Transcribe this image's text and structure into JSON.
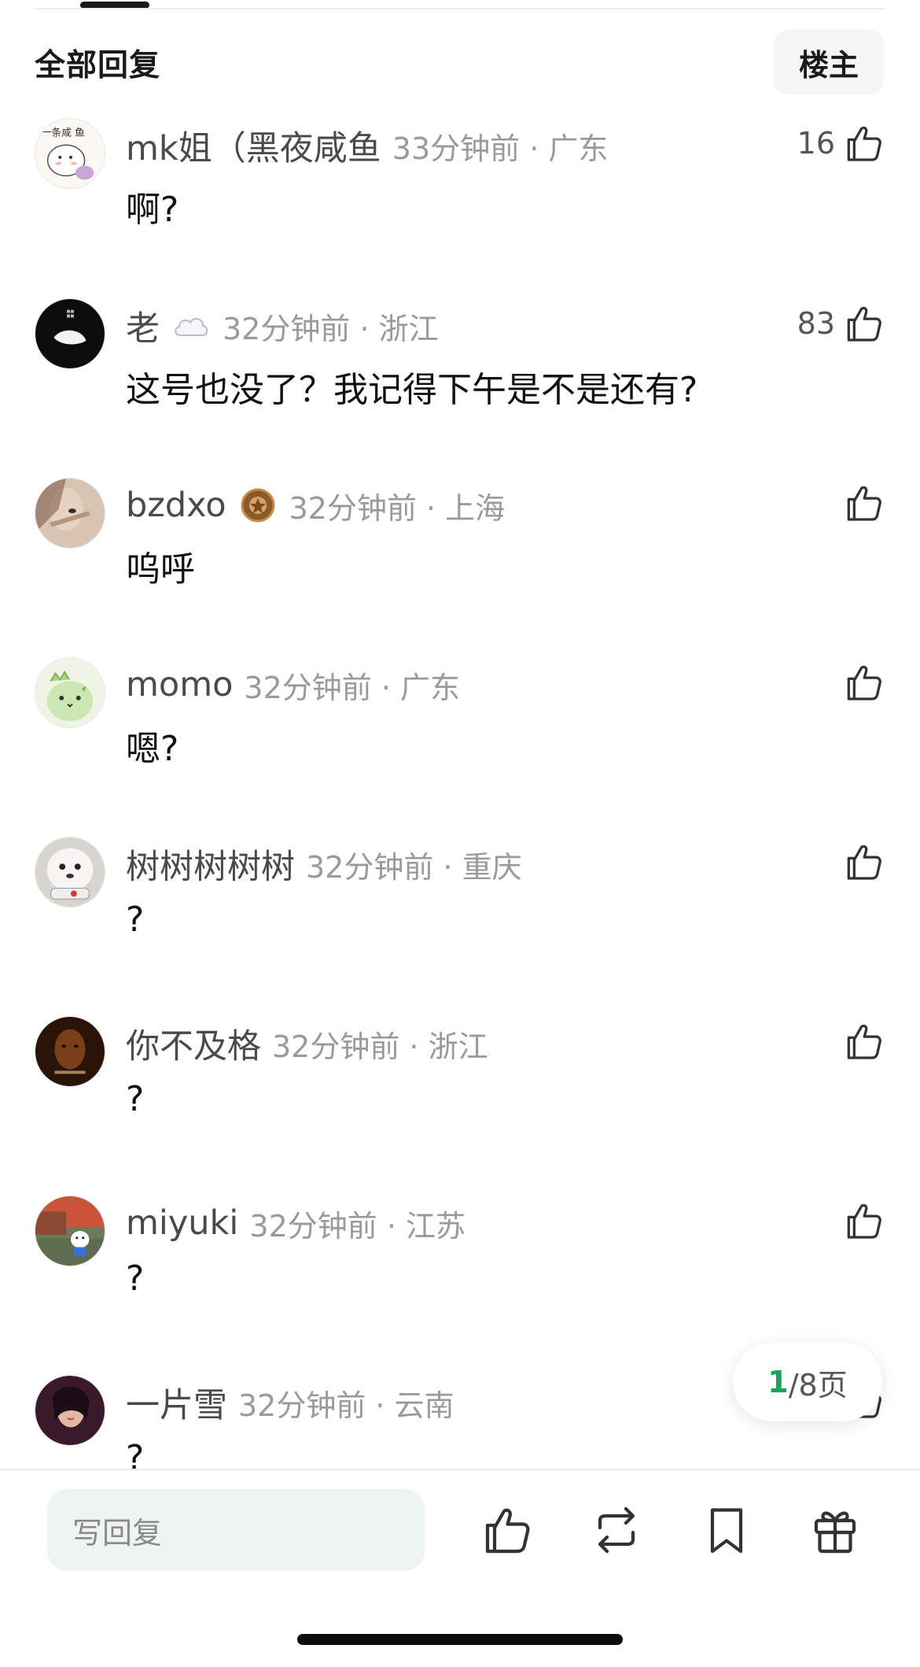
{
  "header": {
    "title": "全部回复",
    "op_button": "楼主"
  },
  "comments": [
    {
      "username": "mk姐（黑夜咸鱼",
      "time_location": "33分钟前 · 广东",
      "text": "啊?",
      "likes": "16",
      "avatar": "cat-sticker-avatar",
      "avatar_text": "一条咸 鱼"
    },
    {
      "username": "老",
      "time_location": "32分钟前 · 浙江",
      "text": "这号也没了？我记得下午是不是还有?",
      "likes": "83",
      "avatar": "dark-avatar",
      "badge": "cloud-icon"
    },
    {
      "username": "bzdxo",
      "time_location": "32分钟前 · 上海",
      "text": "呜呼",
      "likes": "",
      "avatar": "photo-avatar",
      "badge": "medal-icon"
    },
    {
      "username": "momo",
      "time_location": "32分钟前 · 广东",
      "text": "嗯?",
      "likes": "",
      "avatar": "green-cartoon-avatar"
    },
    {
      "username": "树树树树树",
      "time_location": "32分钟前 · 重庆",
      "text": "?",
      "likes": "",
      "avatar": "dog-avatar"
    },
    {
      "username": "你不及格",
      "time_location": "32分钟前 · 浙江",
      "text": "?",
      "likes": "",
      "avatar": "dark-photo-avatar"
    },
    {
      "username": "miyuki",
      "time_location": "32分钟前 · 江苏",
      "text": "?",
      "likes": "",
      "avatar": "scene-avatar"
    },
    {
      "username": "一片雪",
      "time_location": "32分钟前 · 云南",
      "text": "?",
      "likes": "",
      "avatar": "portrait-avatar"
    }
  ],
  "pagination": {
    "current": "1",
    "rest": "/8页"
  },
  "bottom_bar": {
    "reply_placeholder": "写回复",
    "icons": [
      "thumb-up-icon",
      "repost-icon",
      "bookmark-icon",
      "gift-icon"
    ]
  },
  "colors": {
    "accent_green": "#1aa35b",
    "input_bg": "#eef5f0",
    "meta_gray": "#9a9a9a"
  }
}
